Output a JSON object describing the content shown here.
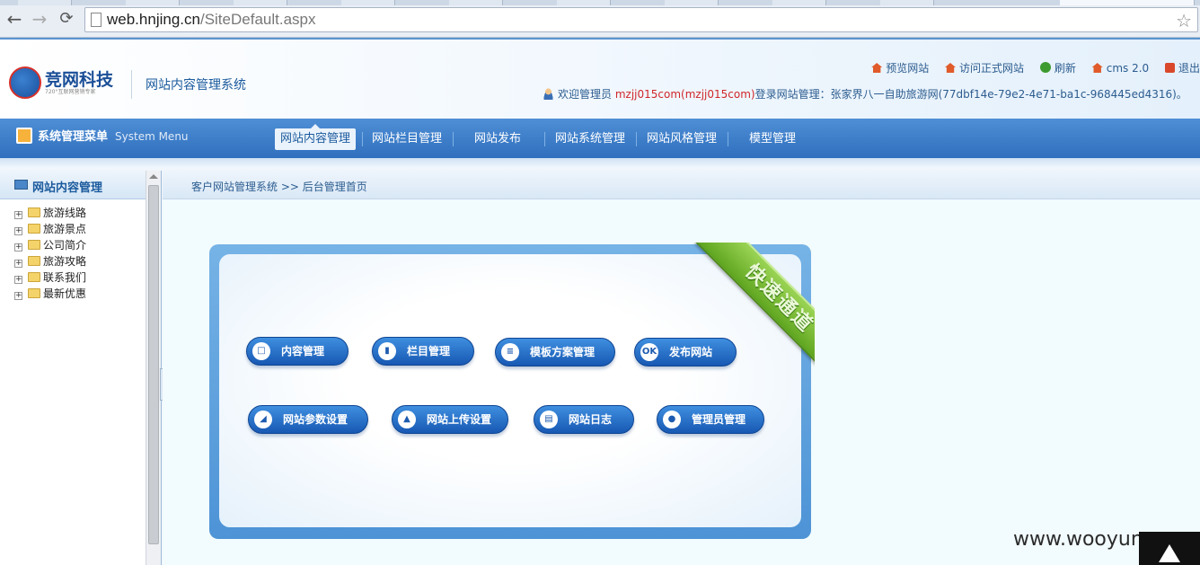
{
  "browser": {
    "back_icon": "arrow-left-icon",
    "forward_icon": "arrow-right-icon",
    "reload_icon": "reload-icon",
    "url_host": "web.hnjing.cn",
    "url_path": "/SiteDefault.aspx",
    "bookmark_icon": "star-icon"
  },
  "header": {
    "logo_text": "竞网科技",
    "logo_sub": "720°互联网营销专家",
    "system_title": "网站内容管理系统",
    "links": [
      {
        "label": "预览网站",
        "icon": "house-icon"
      },
      {
        "label": "访问正式网站",
        "icon": "house-icon"
      },
      {
        "label": "刷新",
        "icon": "refresh-icon"
      },
      {
        "label": "cms 2.0",
        "icon": "house-icon"
      },
      {
        "label": "退出",
        "icon": "exit-icon"
      }
    ],
    "welcome_prefix": "欢迎管理员",
    "welcome_user": "mzjj015com(mzjj015com)",
    "welcome_suffix": "登录网站管理：张家界八一自助旅游网(77dbf14e-79e2-4e71-ba1c-968445ed4316)。"
  },
  "menubar": {
    "system_menu_cn": "系统管理菜单",
    "system_menu_en": "System Menu",
    "items": [
      "网站内容管理",
      "网站栏目管理",
      "网站发布",
      "网站系统管理",
      "网站风格管理",
      "模型管理"
    ],
    "active_index": 0
  },
  "sidebar": {
    "title": "网站内容管理",
    "tree": [
      "旅游线路",
      "旅游景点",
      "公司简介",
      "旅游攻略",
      "联系我们",
      "最新优惠"
    ]
  },
  "main": {
    "breadcrumb": "客户网站管理系统 >> 后台管理首页",
    "ribbon": "快速通道",
    "buttons": [
      {
        "label": "内容管理",
        "icon": "document-icon"
      },
      {
        "label": "栏目管理",
        "icon": "bar-chart-icon"
      },
      {
        "label": "模板方案管理",
        "icon": "list-icon"
      },
      {
        "label": "发布网站",
        "icon": "ok-icon"
      },
      {
        "label": "网站参数设置",
        "icon": "settings-icon"
      },
      {
        "label": "网站上传设置",
        "icon": "upload-icon"
      },
      {
        "label": "网站日志",
        "icon": "log-icon"
      },
      {
        "label": "管理员管理",
        "icon": "user-icon"
      }
    ]
  },
  "watermark": "www.wooyun.org",
  "colors": {
    "menubar": "#2f6fbd",
    "panel": "#4d93d6",
    "ribbon": "#5fa51f",
    "welcome_user": "#d0262a"
  }
}
